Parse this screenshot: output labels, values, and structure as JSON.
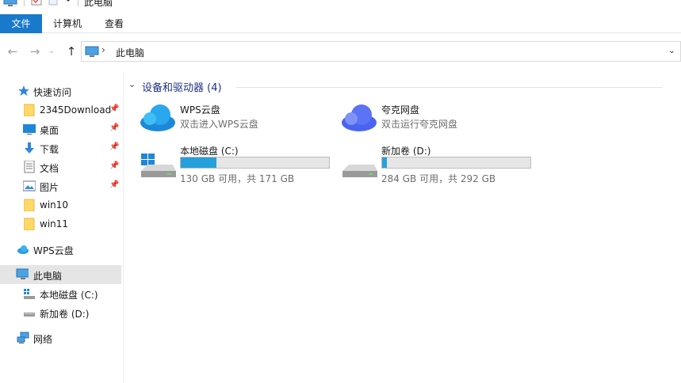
{
  "window": {
    "title": "此电脑"
  },
  "ribbon": {
    "tabs": [
      "文件",
      "计算机",
      "查看"
    ]
  },
  "address": {
    "crumb": "此电脑"
  },
  "navpane": {
    "quick_access": "快速访问",
    "pinned": [
      {
        "label": "2345Download",
        "icon": "folder-icon",
        "pinned": true
      },
      {
        "label": "桌面",
        "icon": "desktop-icon",
        "pinned": true
      },
      {
        "label": "下载",
        "icon": "download-icon",
        "pinned": true
      },
      {
        "label": "文档",
        "icon": "document-icon",
        "pinned": true
      },
      {
        "label": "图片",
        "icon": "pictures-icon",
        "pinned": true
      },
      {
        "label": "win10",
        "icon": "folder-icon",
        "pinned": false
      },
      {
        "label": "win11",
        "icon": "folder-icon",
        "pinned": false
      }
    ],
    "wps": "WPS云盘",
    "this_pc": "此电脑",
    "drive_c": "本地磁盘 (C:)",
    "drive_d": "新加卷 (D:)",
    "network": "网络"
  },
  "content": {
    "group_title": "设备和驱动器 (4)",
    "items": [
      {
        "name": "WPS云盘",
        "sub": "双击进入WPS云盘"
      },
      {
        "name": "夸克网盘",
        "sub": "双击运行夸克网盘"
      }
    ],
    "drives": [
      {
        "name": "本地磁盘 (C:)",
        "free": "130 GB 可用，共 171 GB",
        "used_fraction": 0.24
      },
      {
        "name": "新加卷 (D:)",
        "free": "284 GB 可用，共 292 GB",
        "used_fraction": 0.03
      }
    ]
  },
  "colors": {
    "accent": "#1979ca",
    "bar_fill": "#26a0da",
    "group_title": "#1e3287",
    "selection": "#e5e5e5"
  }
}
